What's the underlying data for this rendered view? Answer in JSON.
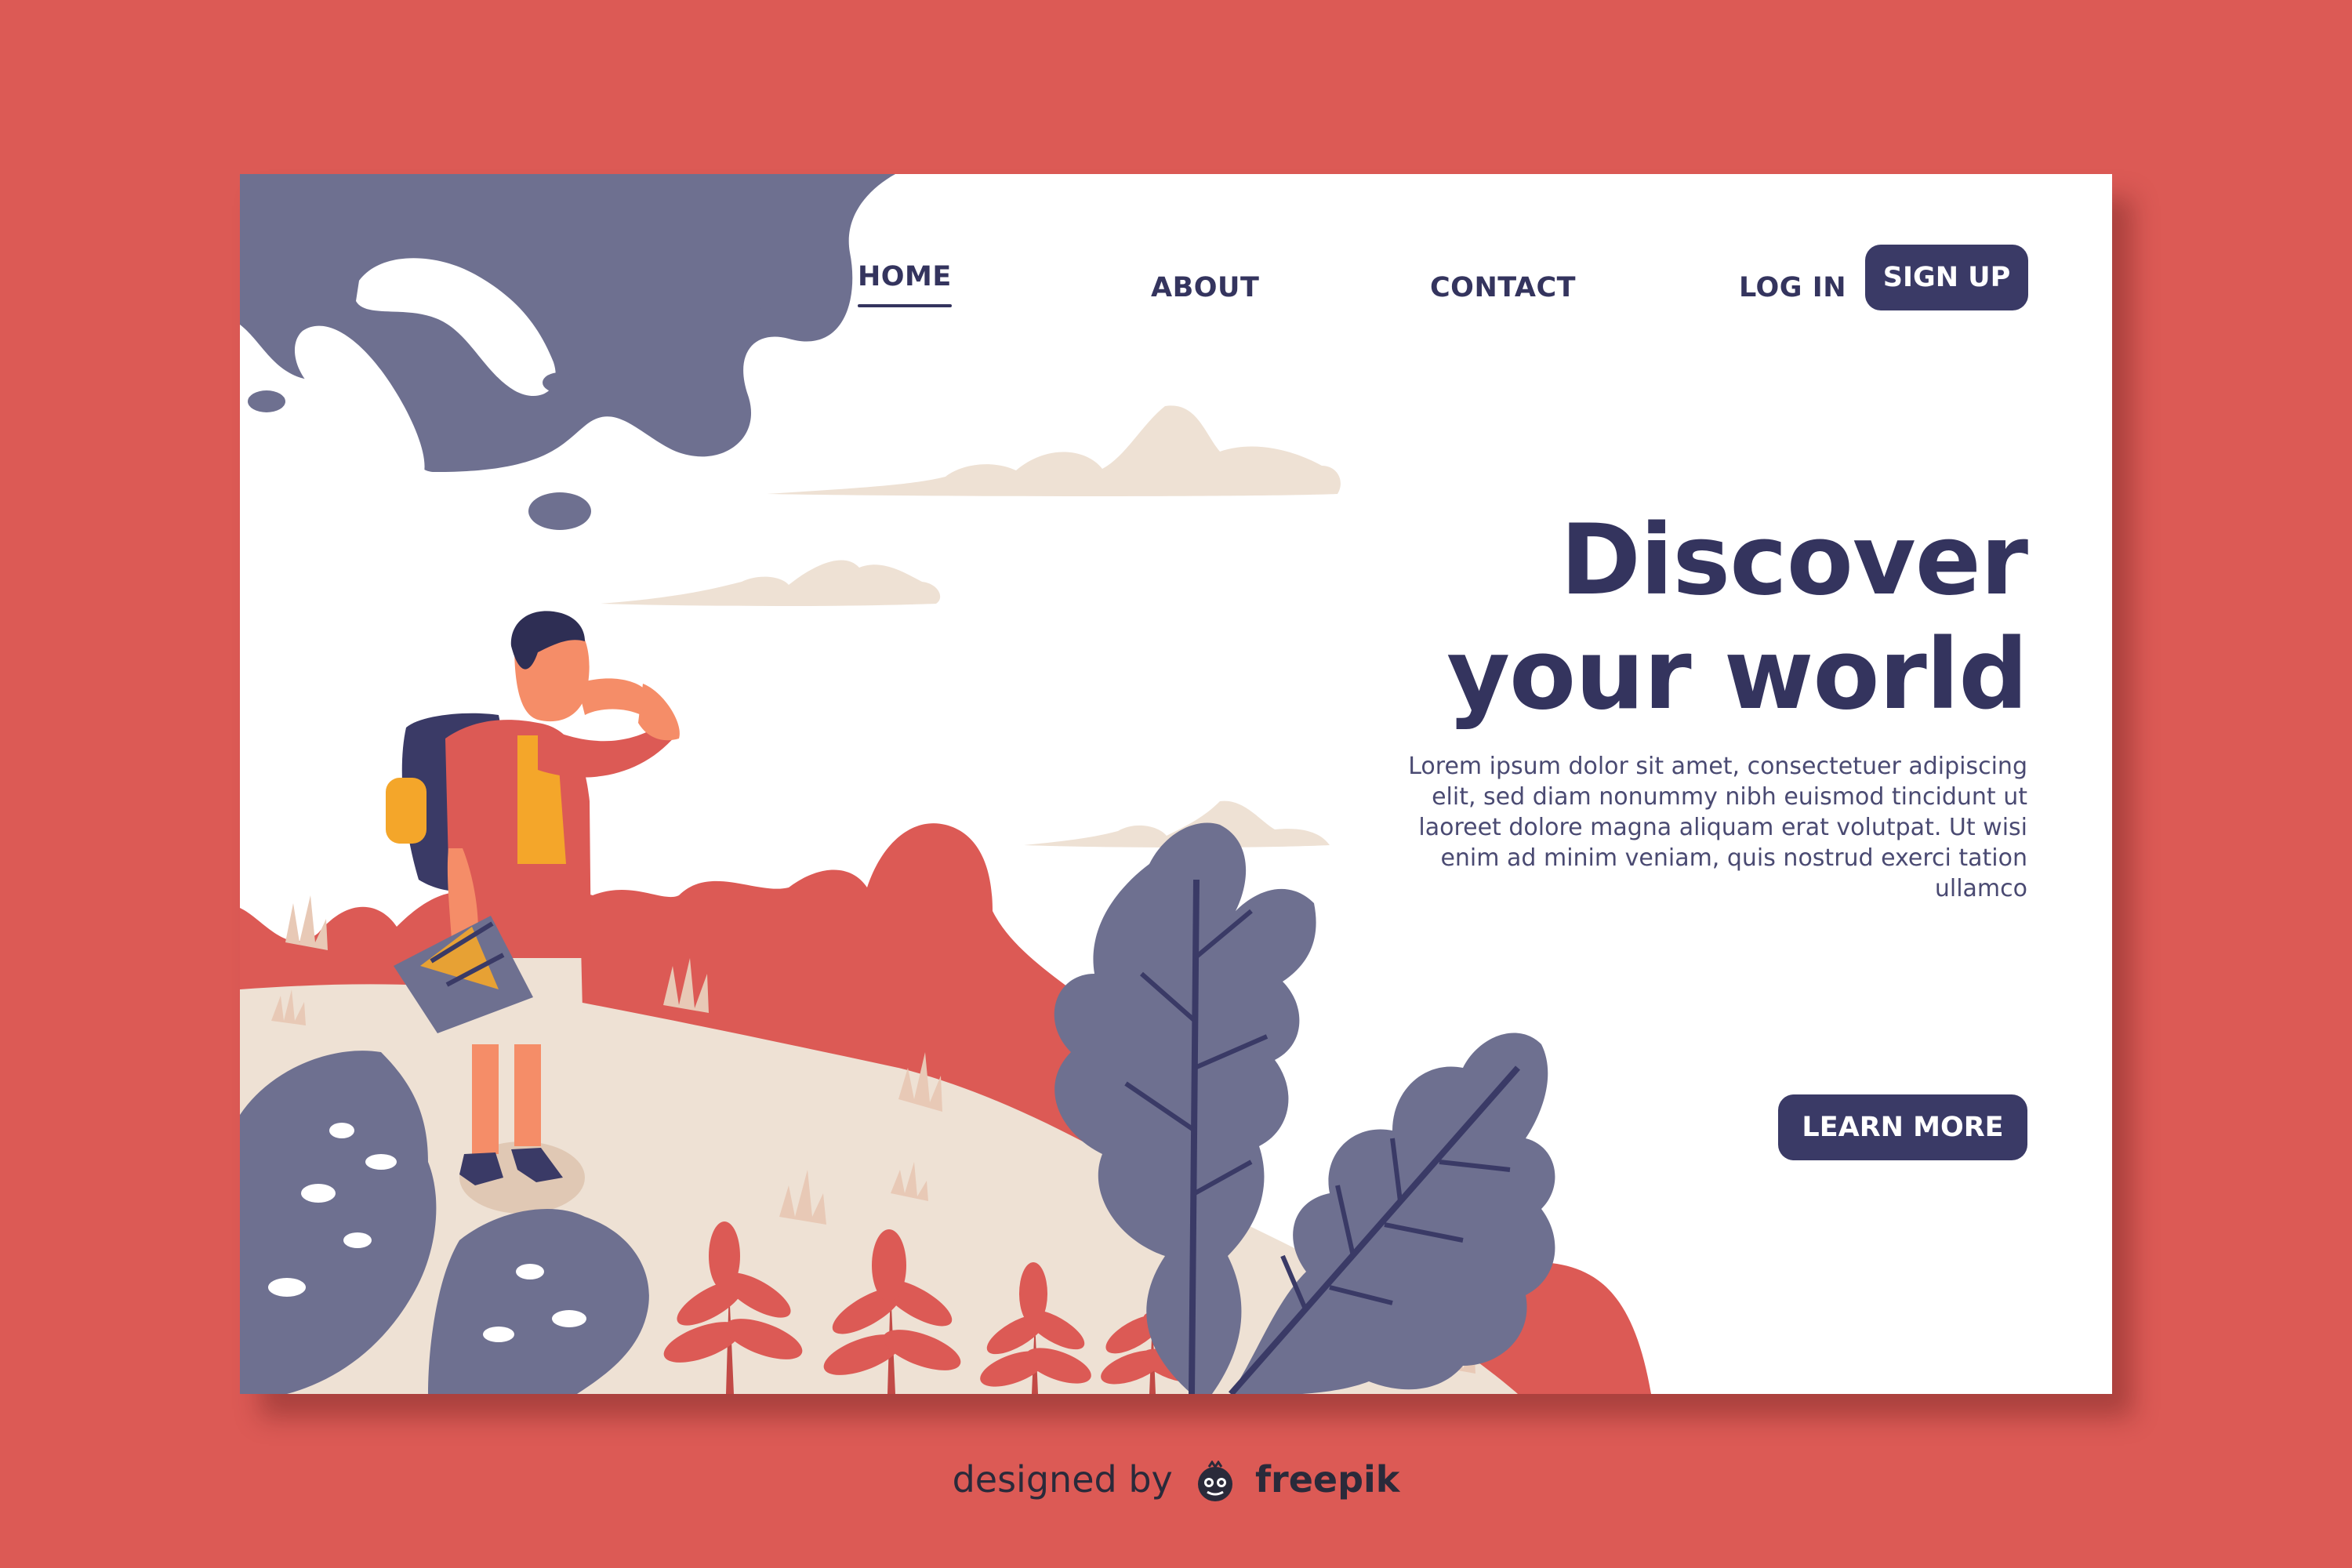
{
  "nav": {
    "home": "HOME",
    "about": "ABOUT",
    "contact": "CONTACT",
    "login": "LOG IN",
    "signup": "SIGN UP"
  },
  "hero": {
    "headline_line1": "Discover",
    "headline_line2": "your world",
    "body": "Lorem ipsum dolor sit amet, consectetuer adipiscing elit, sed diam nonummy nibh euismod tincidunt ut laoreet dolore magna aliquam erat volutpat. Ut wisi enim ad minim veniam, quis nostrud exerci tation ullamco",
    "cta": "LEARN MORE"
  },
  "credit": {
    "prefix": "designed by",
    "brand": "freepik"
  },
  "colors": {
    "background": "#DC5A55",
    "card": "#FFFFFF",
    "navy": "#34345E",
    "slate": "#6E7090",
    "sand": "#EEE1D4",
    "coral": "#DC5A55",
    "mustard": "#F4A62A"
  },
  "icons": {
    "hiker": "hiker-illustration",
    "leaf": "leaf-illustration",
    "cloud": "cloud-illustration",
    "logo": "freepik-logo"
  }
}
